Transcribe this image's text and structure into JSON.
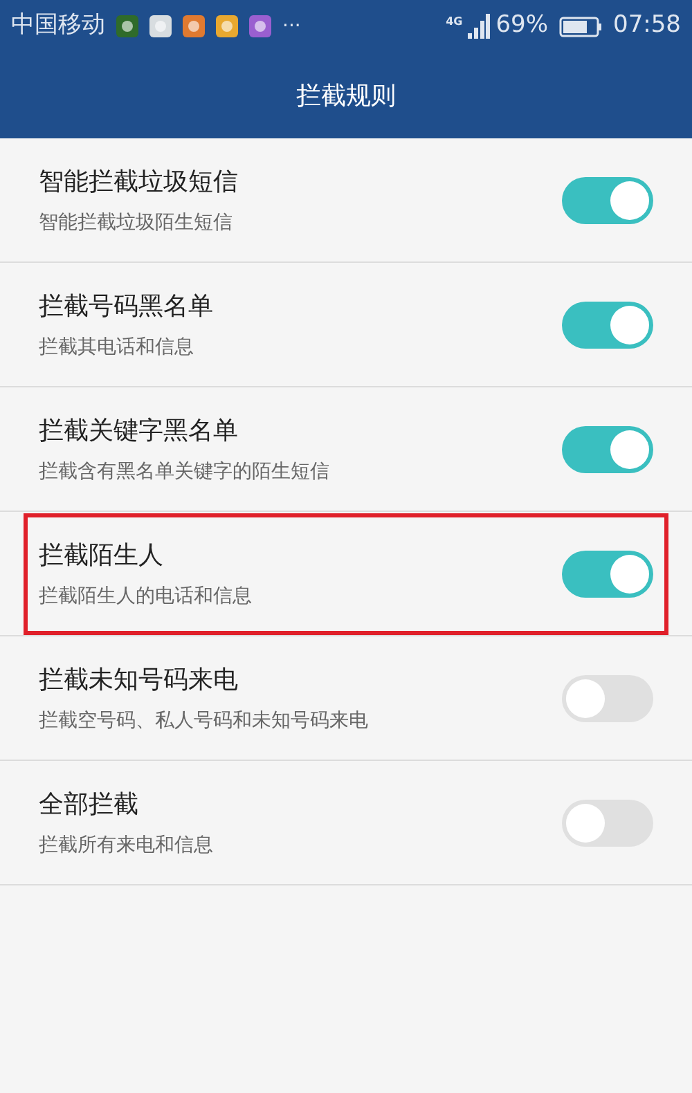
{
  "status_bar": {
    "carrier": "中国移动",
    "more": "···",
    "network": "4G",
    "battery": "69%",
    "time": "07:58"
  },
  "title": "拦截规则",
  "rules": [
    {
      "title": "智能拦截垃圾短信",
      "subtitle": "智能拦截垃圾陌生短信",
      "on": true,
      "highlighted": false
    },
    {
      "title": "拦截号码黑名单",
      "subtitle": "拦截其电话和信息",
      "on": true,
      "highlighted": false
    },
    {
      "title": "拦截关键字黑名单",
      "subtitle": "拦截含有黑名单关键字的陌生短信",
      "on": true,
      "highlighted": false
    },
    {
      "title": "拦截陌生人",
      "subtitle": "拦截陌生人的电话和信息",
      "on": true,
      "highlighted": true
    },
    {
      "title": "拦截未知号码来电",
      "subtitle": "拦截空号码、私人号码和未知号码来电",
      "on": false,
      "highlighted": false
    },
    {
      "title": "全部拦截",
      "subtitle": "拦截所有来电和信息",
      "on": false,
      "highlighted": false
    }
  ]
}
